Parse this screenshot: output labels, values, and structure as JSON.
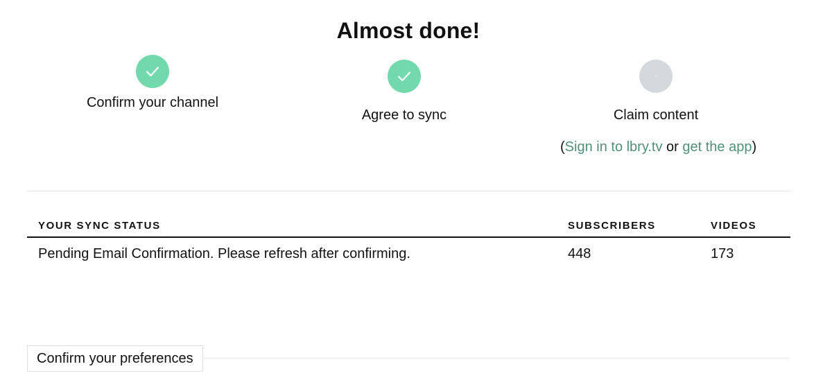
{
  "title": "Almost done!",
  "steps": [
    {
      "label": "Confirm your channel",
      "state": "complete",
      "icon": "checkmark-icon"
    },
    {
      "label": "Agree to sync",
      "state": "complete",
      "icon": "checkmark-icon"
    },
    {
      "label": "Claim content",
      "state": "pending",
      "icon": "dot-icon"
    }
  ],
  "app_links": {
    "open_paren": "(",
    "sign_in": "Sign in to lbry.tv",
    "or": " or ",
    "get_app": "get the app",
    "close_paren": ")"
  },
  "sync_table": {
    "headers": [
      "YOUR SYNC STATUS",
      "SUBSCRIBERS",
      "VIDEOS"
    ],
    "rows": [
      {
        "status": "Pending Email Confirmation. Please refresh after confirming.",
        "subscribers": "448",
        "videos": "173"
      }
    ]
  },
  "preferences": {
    "label": "Confirm your preferences"
  },
  "colors": {
    "step_complete": "#72d9ad",
    "step_pending": "#d4d9de",
    "link": "#4f8f76",
    "text": "#111111"
  }
}
